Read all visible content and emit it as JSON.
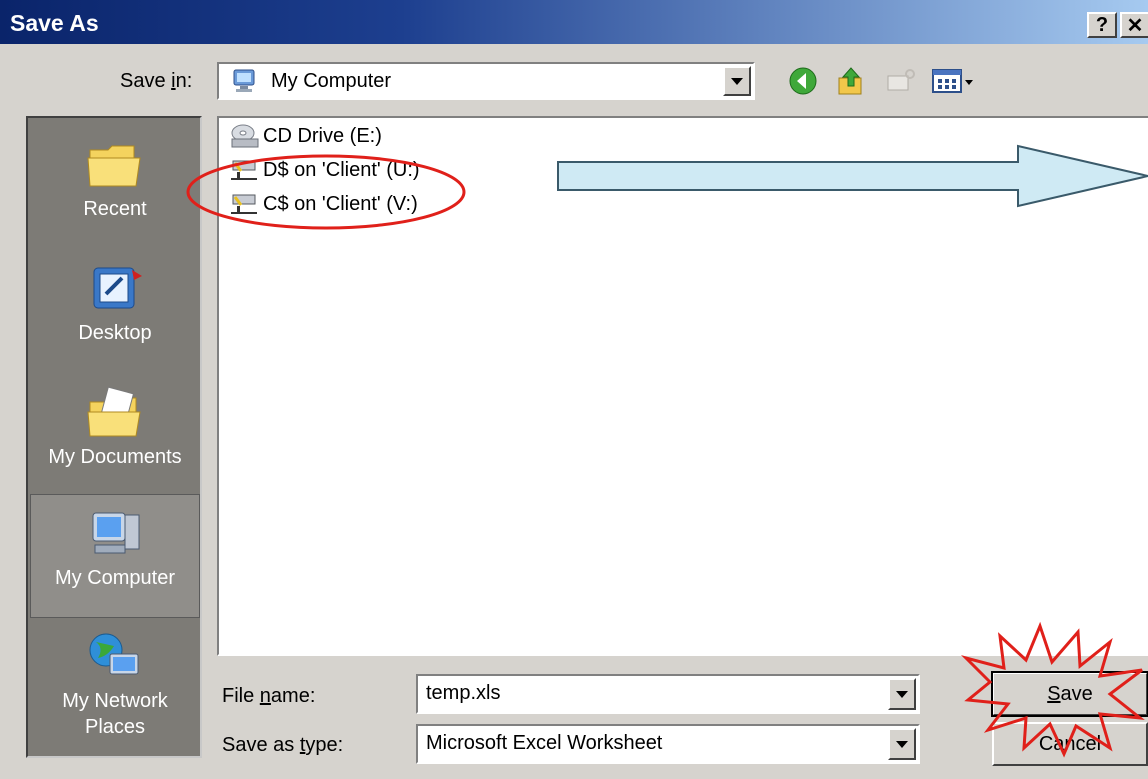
{
  "window": {
    "title": "Save As",
    "help_glyph": "?",
    "close_glyph": "✕"
  },
  "save_in": {
    "label_pre": "Save ",
    "label_access": "i",
    "label_post": "n:",
    "value": "My Computer",
    "icon": "my-computer-icon"
  },
  "toolbar": [
    {
      "name": "back-icon"
    },
    {
      "name": "up-folder-icon"
    },
    {
      "name": "new-folder-icon"
    },
    {
      "name": "views-menu-icon"
    }
  ],
  "places": [
    {
      "label": "Recent",
      "icon": "recent-folder-icon"
    },
    {
      "label": "Desktop",
      "icon": "desktop-icon"
    },
    {
      "label": "My Documents",
      "icon": "my-documents-icon"
    },
    {
      "label": "My Computer",
      "icon": "my-computer-icon",
      "selected": true
    },
    {
      "label": "My Network\nPlaces",
      "icon": "network-places-icon"
    }
  ],
  "files": [
    {
      "name": "CD Drive (E:)",
      "icon": "cd-drive-icon"
    },
    {
      "name": "D$ on 'Client' (U:)",
      "icon": "network-drive-icon"
    },
    {
      "name": "C$ on 'Client' (V:)",
      "icon": "network-drive-icon"
    }
  ],
  "file_name": {
    "label_pre": "File ",
    "label_access": "n",
    "label_post": "ame:",
    "value": "temp.xls"
  },
  "save_type": {
    "label_pre": "Save as ",
    "label_access": "t",
    "label_post": "ype:",
    "value": "Microsoft Excel Worksheet"
  },
  "buttons": {
    "save_access": "S",
    "save_rest": "ave",
    "cancel": "Cancel"
  },
  "annotations": {
    "circle_color": "#e0201a",
    "arrow_fill": "#cfeaf4",
    "arrow_stroke": "#3a5a6a"
  }
}
